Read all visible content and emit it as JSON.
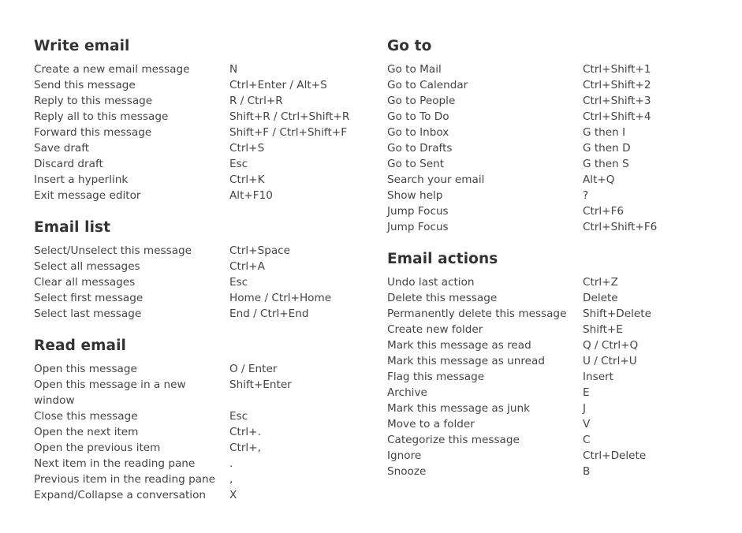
{
  "columns": [
    {
      "sections": [
        {
          "title": "Write email",
          "rows": [
            {
              "action": "Create a new email message",
              "keys": "N"
            },
            {
              "action": "Send this message",
              "keys": "Ctrl+Enter / Alt+S"
            },
            {
              "action": "Reply to this message",
              "keys": "R / Ctrl+R"
            },
            {
              "action": "Reply all to this message",
              "keys": "Shift+R / Ctrl+Shift+R"
            },
            {
              "action": "Forward this message",
              "keys": "Shift+F / Ctrl+Shift+F"
            },
            {
              "action": "Save draft",
              "keys": "Ctrl+S"
            },
            {
              "action": "Discard draft",
              "keys": "Esc"
            },
            {
              "action": "Insert a hyperlink",
              "keys": "Ctrl+K"
            },
            {
              "action": "Exit message editor",
              "keys": "Alt+F10"
            }
          ]
        },
        {
          "title": "Email list",
          "rows": [
            {
              "action": "Select/Unselect this message",
              "keys": "Ctrl+Space"
            },
            {
              "action": "Select all messages",
              "keys": "Ctrl+A"
            },
            {
              "action": "Clear all messages",
              "keys": "Esc"
            },
            {
              "action": "Select first message",
              "keys": "Home / Ctrl+Home"
            },
            {
              "action": "Select last message",
              "keys": "End / Ctrl+End"
            }
          ]
        },
        {
          "title": "Read email",
          "rows": [
            {
              "action": "Open this message",
              "keys": "O / Enter"
            },
            {
              "action": "Open this message in a new window",
              "keys": "Shift+Enter"
            },
            {
              "action": "Close this message",
              "keys": "Esc"
            },
            {
              "action": "Open the next item",
              "keys": "Ctrl+."
            },
            {
              "action": "Open the previous item",
              "keys": "Ctrl+,"
            },
            {
              "action": "Next item in the reading pane",
              "keys": "."
            },
            {
              "action": "Previous item in the reading pane",
              "keys": ","
            },
            {
              "action": "Expand/Collapse a conversation",
              "keys": "X"
            }
          ]
        }
      ]
    },
    {
      "sections": [
        {
          "title": "Go to",
          "rows": [
            {
              "action": "Go to Mail",
              "keys": "Ctrl+Shift+1"
            },
            {
              "action": "Go to Calendar",
              "keys": "Ctrl+Shift+2"
            },
            {
              "action": "Go to People",
              "keys": "Ctrl+Shift+3"
            },
            {
              "action": "Go to To Do",
              "keys": "Ctrl+Shift+4"
            },
            {
              "action": "Go to Inbox",
              "keys": "G then I"
            },
            {
              "action": "Go to Drafts",
              "keys": "G then D"
            },
            {
              "action": "Go to Sent",
              "keys": "G then S"
            },
            {
              "action": "Search your email",
              "keys": "Alt+Q"
            },
            {
              "action": "Show help",
              "keys": "?"
            },
            {
              "action": "Jump Focus",
              "keys": "Ctrl+F6"
            },
            {
              "action": "Jump Focus",
              "keys": "Ctrl+Shift+F6"
            }
          ]
        },
        {
          "title": "Email actions",
          "rows": [
            {
              "action": "Undo last action",
              "keys": "Ctrl+Z"
            },
            {
              "action": "Delete this message",
              "keys": "Delete"
            },
            {
              "action": "Permanently delete this message",
              "keys": "Shift+Delete"
            },
            {
              "action": "Create new folder",
              "keys": "Shift+E"
            },
            {
              "action": "Mark this message as read",
              "keys": "Q / Ctrl+Q"
            },
            {
              "action": "Mark this message as unread",
              "keys": "U / Ctrl+U"
            },
            {
              "action": "Flag this message",
              "keys": "Insert"
            },
            {
              "action": "Archive",
              "keys": "E"
            },
            {
              "action": "Mark this message as junk",
              "keys": "J"
            },
            {
              "action": "Move to a folder",
              "keys": "V"
            },
            {
              "action": "Categorize this message",
              "keys": "C"
            },
            {
              "action": "Ignore",
              "keys": "Ctrl+Delete"
            },
            {
              "action": "Snooze",
              "keys": "B"
            }
          ]
        }
      ]
    }
  ]
}
